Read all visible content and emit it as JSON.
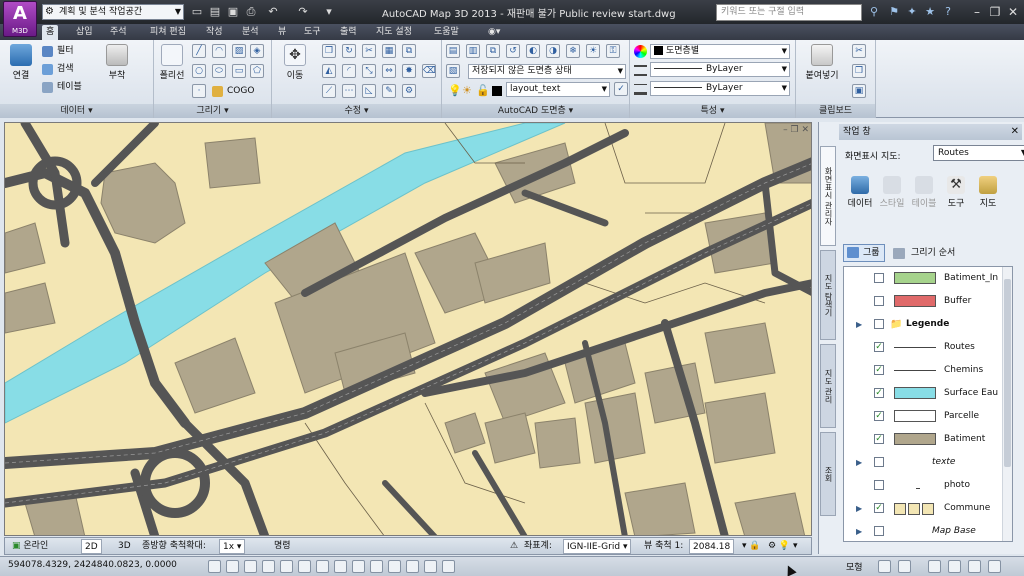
{
  "titlebar": {
    "logo_text": "A",
    "logo_sub": "M3D",
    "workspace": "계획 및 분석 작업공간",
    "title": "AutoCAD Map 3D 2013 - 재판매 불가    Public review start.dwg",
    "search_placeholder": "키워드 또는 구절 입력"
  },
  "tabs": [
    "홈",
    "삽입",
    "주석",
    "피쳐 편집",
    "작성",
    "분석",
    "뷰",
    "도구",
    "출력",
    "지도 설정",
    "도움말"
  ],
  "ribbon": {
    "data_panel": {
      "connect": "연결",
      "filter": "필터",
      "search": "검색",
      "table": "테이블",
      "attach": "부착",
      "title": "데이터"
    },
    "draw_panel": {
      "polyline": "폴리선",
      "cogo": "COGO",
      "title": "그리기"
    },
    "modify_panel": {
      "move": "이동",
      "title": "수정"
    },
    "layer_panel": {
      "layer_state": "저장되지 않은 도면층 상태",
      "current_layer": "layout_text",
      "title": "AutoCAD 도면층"
    },
    "properties_panel": {
      "color": "도면층별",
      "linetype": "ByLayer",
      "lineweight": "ByLayer",
      "title": "특성"
    },
    "clipboard_panel": {
      "paste": "붙여넣기",
      "title": "클립보드"
    }
  },
  "taskpane": {
    "title": "작업 창",
    "vtabs": [
      "화면표시 관리자",
      "지도 탐색기",
      "지도 관리",
      "조회"
    ],
    "display_label": "화면표시 지도:",
    "display_value": "Routes",
    "tools": [
      "데이터",
      "스타일",
      "테이블",
      "도구",
      "지도"
    ],
    "group_button": "그룹",
    "draw_order": "그리기 순서",
    "layers": [
      {
        "label": "Batiment_In",
        "checked": false,
        "expand": false,
        "bold": false,
        "italic": false
      },
      {
        "label": "Buffer",
        "checked": false,
        "expand": false,
        "bold": false,
        "italic": false
      },
      {
        "label": "Legende",
        "checked": false,
        "expand": true,
        "bold": true,
        "italic": false
      },
      {
        "label": "Routes",
        "checked": true,
        "expand": false,
        "bold": false,
        "italic": false
      },
      {
        "label": "Chemins",
        "checked": true,
        "expand": false,
        "bold": false,
        "italic": false
      },
      {
        "label": "Surface Eau",
        "checked": true,
        "expand": false,
        "bold": false,
        "italic": false
      },
      {
        "label": "Parcelle",
        "checked": true,
        "expand": false,
        "bold": false,
        "italic": false
      },
      {
        "label": "Batiment",
        "checked": true,
        "expand": false,
        "bold": false,
        "italic": false
      },
      {
        "label": "texte",
        "checked": false,
        "expand": true,
        "bold": false,
        "italic": true
      },
      {
        "label": "photo",
        "checked": false,
        "expand": false,
        "bold": false,
        "italic": false
      },
      {
        "label": "Commune",
        "checked": true,
        "expand": true,
        "bold": false,
        "italic": false
      },
      {
        "label": "Map Base",
        "checked": false,
        "expand": true,
        "bold": false,
        "italic": true
      }
    ]
  },
  "bottom_bar": {
    "online": "온라인",
    "mode_2d": "2D",
    "mode_3d": "3D",
    "zoom_label": "종방향 축척확대:",
    "zoom_value": "1x",
    "command": "명령",
    "coord_label": "좌표계:",
    "coord_value": "IGN-IIE-Grid",
    "view_scale_label": "뷰 축척 1:",
    "view_scale_value": "2084.18"
  },
  "statusbar": {
    "coords": "594078.4329, 2424840.0823, 0.0000",
    "model": "모형"
  },
  "colors": {
    "map_background": "#f3e6b4",
    "water": "#88dde6",
    "road": "#555555",
    "building": "#b0a68c",
    "legend_batiment_in": "#a6d38c",
    "legend_buffer": "#e06a6a",
    "legend_surface_eau": "#88dde6",
    "legend_batiment": "#b0a68c",
    "legend_commune": "#f3e6b4"
  }
}
